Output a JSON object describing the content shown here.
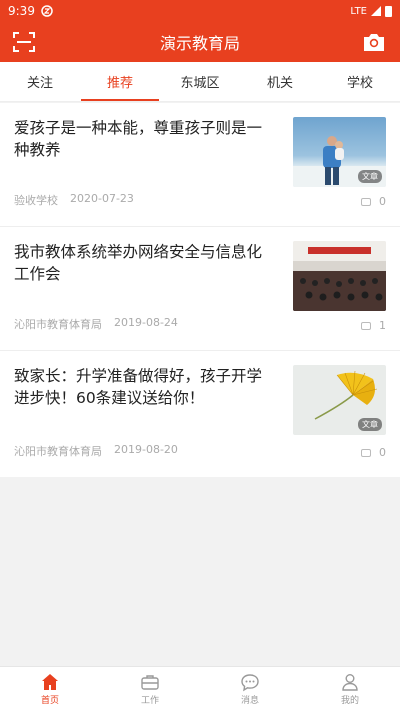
{
  "status": {
    "time": "9:39",
    "network": "LTE"
  },
  "header": {
    "title": "演示教育局"
  },
  "tabs": [
    {
      "label": "关注"
    },
    {
      "label": "推荐"
    },
    {
      "label": "东城区"
    },
    {
      "label": "机关"
    },
    {
      "label": "学校"
    }
  ],
  "active_tab": "推荐",
  "articles": [
    {
      "title": "爱孩子是一种本能，尊重孩子则是一种教养",
      "source": "验收学校",
      "date": "2020-07-23",
      "comments": "0",
      "badge": "文章"
    },
    {
      "title": "我市教体系统举办网络安全与信息化工作会",
      "source": "沁阳市教育体育局",
      "date": "2019-08-24",
      "comments": "1",
      "badge": ""
    },
    {
      "title": "致家长：升学准备做得好，孩子开学进步快！60条建议送给你！",
      "source": "沁阳市教育体育局",
      "date": "2019-08-20",
      "comments": "0",
      "badge": "文章"
    }
  ],
  "bottom_nav": [
    {
      "label": "首页",
      "icon": "home-icon"
    },
    {
      "label": "工作",
      "icon": "briefcase-icon"
    },
    {
      "label": "消息",
      "icon": "chat-icon"
    },
    {
      "label": "我的",
      "icon": "user-icon"
    }
  ],
  "colors": {
    "brand": "#e8401f",
    "background": "#f2f2f2"
  }
}
